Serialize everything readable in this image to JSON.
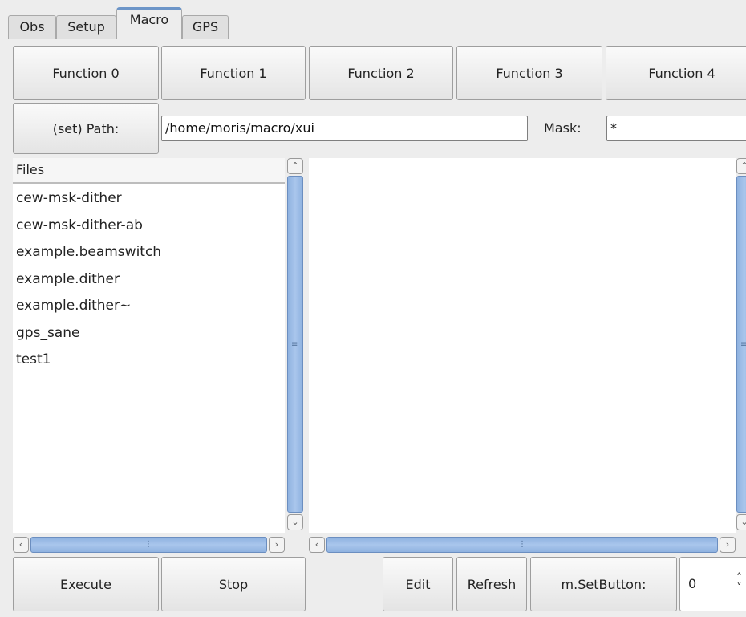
{
  "tabs": [
    "Obs",
    "Setup",
    "Macro",
    "GPS"
  ],
  "functions": [
    "Function 0",
    "Function 1",
    "Function 2",
    "Function 3",
    "Function 4"
  ],
  "path": {
    "button_label": "(set) Path:",
    "value": "/home/moris/macro/xui",
    "mask_label": "Mask:",
    "mask_value": "*"
  },
  "files": {
    "header": "Files",
    "items": [
      "cew-msk-dither",
      "cew-msk-dither-ab",
      "example.beamswitch",
      "example.dither",
      "example.dither~",
      "gps_sane",
      "test1"
    ]
  },
  "bottom": {
    "execute": "Execute",
    "stop": "Stop",
    "edit": "Edit",
    "refresh": "Refresh",
    "setbutton_label": "m.SetButton:",
    "setbutton_value": "0"
  },
  "colors": {
    "accent": "#6c95c8",
    "scroll_thumb": "#a9c6ec"
  },
  "icons": {
    "up": "chevron-up-icon",
    "down": "chevron-down-icon",
    "left": "chevron-left-icon",
    "right": "chevron-right-icon",
    "spin": "spinner-icon",
    "grip": "grip-icon"
  }
}
